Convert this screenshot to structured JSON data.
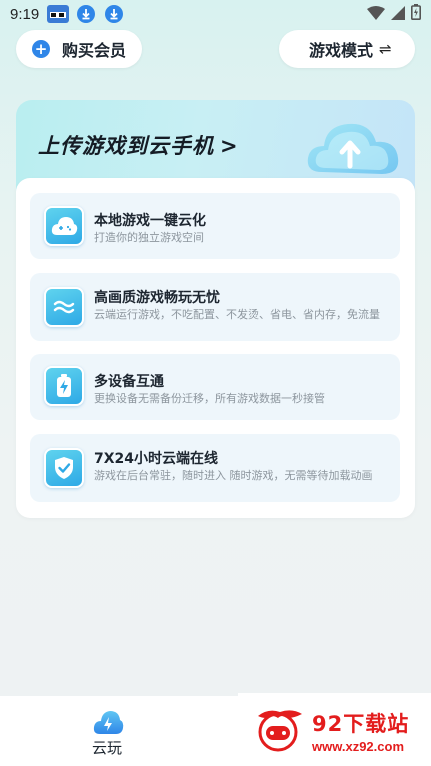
{
  "status_bar": {
    "time": "9:19",
    "icons": [
      "app-icon",
      "download-icon",
      "download-icon",
      "wifi-icon",
      "signal-icon",
      "battery-icon"
    ]
  },
  "header": {
    "vip_button": "购买会员",
    "mode_button": "游戏模式",
    "mode_icon": "⇌"
  },
  "upload_banner": {
    "title": "上传游戏到云手机",
    "chevron": ">"
  },
  "features": [
    {
      "icon": "cloud-gamepad-icon",
      "title": "本地游戏一键云化",
      "desc": "打造你的独立游戏空间"
    },
    {
      "icon": "waves-icon",
      "title": "高画质游戏畅玩无忧",
      "desc": "云端运行游戏，不吃配置、不发烫、省电、省内存，免流量"
    },
    {
      "icon": "battery-bolt-icon",
      "title": "多设备互通",
      "desc": "更换设备无需备份迁移，所有游戏数据一秒接管"
    },
    {
      "icon": "shield-check-icon",
      "title": "7X24小时云端在线",
      "desc": "游戏在后台常驻，随时进入 随时游戏，无需等待加载动画"
    }
  ],
  "bottom_nav": {
    "items": [
      {
        "label": "云玩",
        "icon": "cloud-bolt-icon",
        "active": true
      }
    ]
  },
  "watermark": {
    "name": "92下载站",
    "url": "www.xz92.com"
  },
  "colors": {
    "accent": "#2f86e8",
    "icon_gradient_start": "#5fd3ee",
    "icon_gradient_end": "#2ea9e6",
    "watermark_red": "#e31d1d"
  }
}
